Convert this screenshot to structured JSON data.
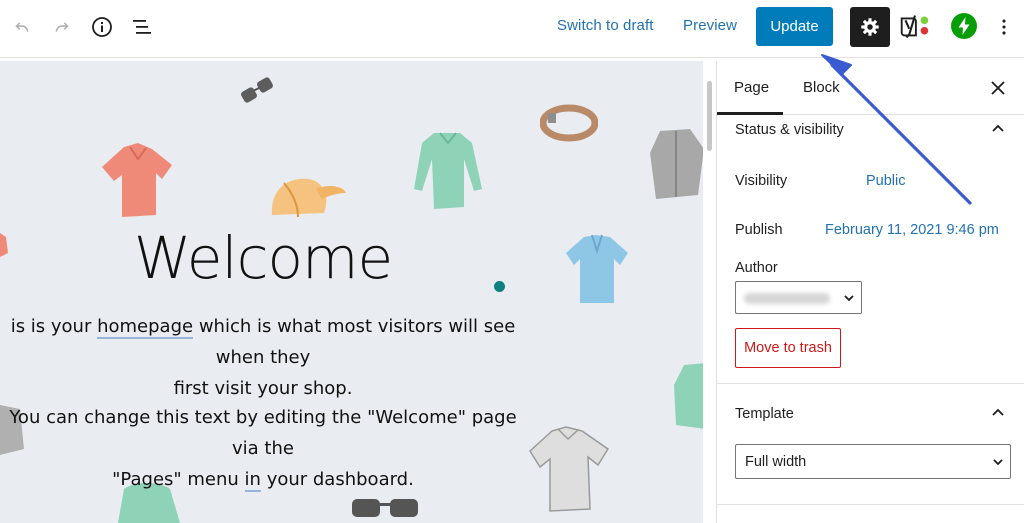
{
  "toolbar": {
    "undo_icon": "undo-icon",
    "redo_icon": "redo-icon",
    "info_icon": "info-icon",
    "list_view_icon": "list-view-icon",
    "switch_to_draft": "Switch to draft",
    "preview": "Preview",
    "update": "Update",
    "settings_icon": "gear-icon",
    "yoast_icon": "yoast-icon",
    "jetpack_icon": "jetpack-icon",
    "more_icon": "more-vertical-icon"
  },
  "canvas": {
    "heading": "Welcome",
    "para1_pre": "is is your ",
    "para1_link": "homepage",
    "para1_post": " which is what most visitors will see when they",
    "para1_line2": "first visit your shop.",
    "para2_line1": "You can change this text by editing the \"Welcome\" page via the",
    "para2_pre": "\"Pages\" menu ",
    "para2_link": "in",
    "para2_post": " your dashboard."
  },
  "sidebar": {
    "tabs": [
      {
        "label": "Page",
        "active": true
      },
      {
        "label": "Block",
        "active": false
      }
    ],
    "status_panel": {
      "title": "Status & visibility",
      "visibility_label": "Visibility",
      "visibility_value": "Public",
      "publish_label": "Publish",
      "publish_value": "February 11, 2021 9:46 pm",
      "author_label": "Author",
      "trash_button": "Move to trash"
    },
    "template_panel": {
      "title": "Template",
      "selected": "Full width"
    }
  },
  "colors": {
    "accent": "#007cba",
    "link": "#2271b1",
    "danger": "#cc1818",
    "arrow": "#3a5bd0",
    "jetpack": "#069e08"
  }
}
